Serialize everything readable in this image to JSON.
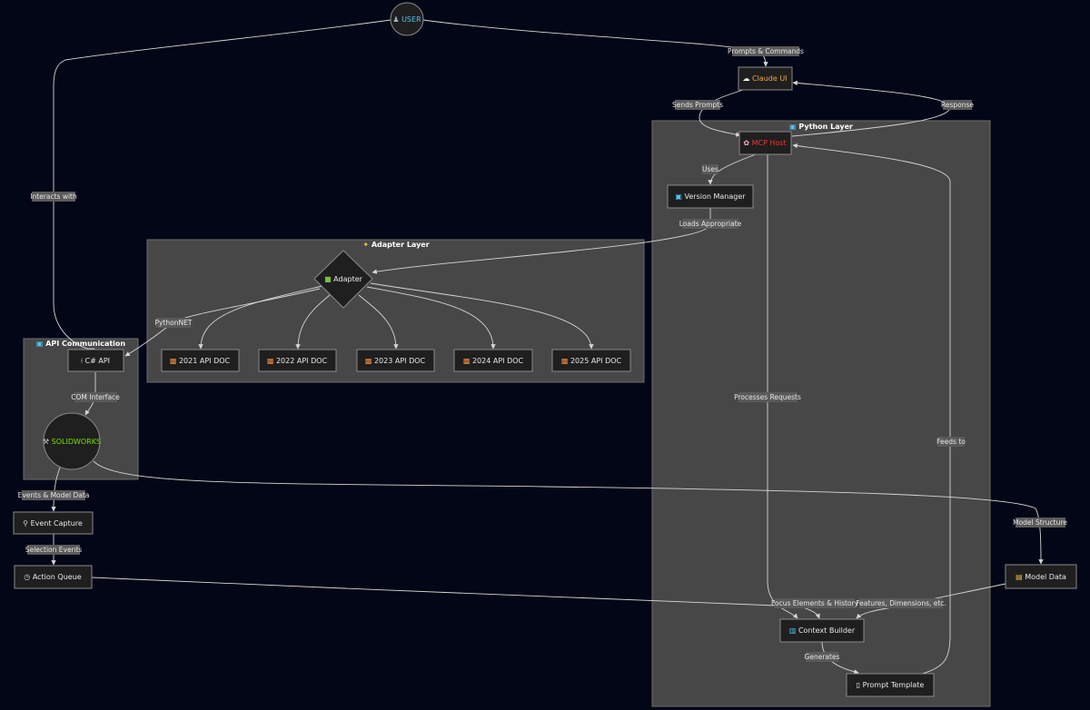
{
  "colors": {
    "background": "#030616",
    "cluster_fill": "#474747",
    "node_fill": "#1f1f1f",
    "user_text": "#4fc3f7",
    "claude_text": "#f0a84a",
    "mcp_text": "#e53935",
    "solidworks_text": "#76e000",
    "doc_icon": "#f08a3c"
  },
  "clusters": {
    "python": {
      "title": "Python Layer",
      "icon": "computer-icon"
    },
    "adapter": {
      "title": "Adapter Layer",
      "icon": "puzzle-icon"
    },
    "api": {
      "title": "API Communication",
      "icon": "connector-icon"
    }
  },
  "nodes": {
    "user": {
      "label": "USER",
      "icon": "person-icon"
    },
    "claude": {
      "label": "Claude UI",
      "icon": "cloud-icon"
    },
    "mcp": {
      "label": "MCP Host",
      "icon": "brain-icon"
    },
    "version": {
      "label": "Version Manager",
      "icon": "gear-icon"
    },
    "adapter": {
      "label": "Adapter",
      "icon": "package-icon"
    },
    "doc2021": {
      "label": "2021 API DOC",
      "icon": "document-icon"
    },
    "doc2022": {
      "label": "2022 API DOC",
      "icon": "document-icon"
    },
    "doc2023": {
      "label": "2023 API DOC",
      "icon": "document-icon"
    },
    "doc2024": {
      "label": "2024 API DOC",
      "icon": "document-icon"
    },
    "doc2025": {
      "label": "2025 API DOC",
      "icon": "document-icon"
    },
    "csharp": {
      "label": "C# API",
      "icon": "pin-icon"
    },
    "solidworks": {
      "label": "SOLIDWORKS",
      "icon": "wrench-icon"
    },
    "event": {
      "label": "Event Capture",
      "icon": "probe-icon"
    },
    "queue": {
      "label": "Action Queue",
      "icon": "clock-icon"
    },
    "model": {
      "label": "Model Data",
      "icon": "database-icon"
    },
    "context": {
      "label": "Context Builder",
      "icon": "chart-icon"
    },
    "prompt": {
      "label": "Prompt Template",
      "icon": "page-icon"
    }
  },
  "edges": {
    "prompts_commands": "Prompts & Commands",
    "interacts_with": "Interacts with",
    "sends_prompts": "Sends Prompts",
    "response": "Response",
    "uses": "Uses",
    "loads_appropriate": "Loads Appropriate",
    "processes_requests": "Processes Requests",
    "feeds_to": "Feeds to",
    "pythonnet": "PythonNET",
    "com_interface": "COM Interface",
    "events_model_data": "Events & Model Data",
    "model_structure": "Model Structure",
    "selection_events": "Selection Events",
    "focus_elements": "Focus Elements & History",
    "features_dimensions": "Features, Dimensions, etc.",
    "generates": "Generates"
  }
}
